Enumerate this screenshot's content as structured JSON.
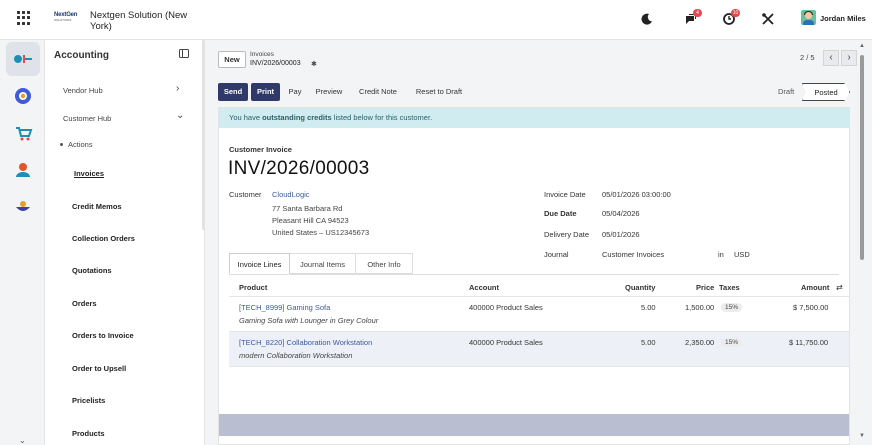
{
  "brand": {
    "logo_line1": "NextGen",
    "logo_line2": "SOLUTIONS",
    "company": "Nextgen Solution (New York)"
  },
  "topbar": {
    "icons": [
      "apps-grid-icon",
      "moon-icon",
      "chat-icon",
      "clock-icon",
      "tools-icon"
    ],
    "chat_badge": "4",
    "activity_badge": "10",
    "user_name": "Jordan Miles"
  },
  "sidebar": {
    "title": "Accounting",
    "items": [
      {
        "label": "Vendor Hub",
        "chevron": "›"
      },
      {
        "label": "Customer Hub",
        "chevron": "⌄"
      },
      {
        "label": "Actions"
      },
      {
        "label": "Invoices"
      },
      {
        "label": "Credit Memos"
      },
      {
        "label": "Collection Orders"
      },
      {
        "label": "Quotations"
      },
      {
        "label": "Orders"
      },
      {
        "label": "Orders to Invoice"
      },
      {
        "label": "Order to Upsell"
      },
      {
        "label": "Pricelists"
      },
      {
        "label": "Products"
      }
    ]
  },
  "control": {
    "new_label": "New",
    "breadcrumb_parent": "Invoices",
    "breadcrumb_current": "INV/2026/00003",
    "pager": "2 / 5",
    "actions": [
      "Send",
      "Print",
      "Pay",
      "Preview",
      "Credit Note",
      "Reset to Draft"
    ],
    "status_draft": "Draft",
    "status_posted": "Posted"
  },
  "alert": {
    "pre": "You have ",
    "bold": "outstanding credits",
    "post": " listed below for this customer."
  },
  "invoice": {
    "kind": "Customer Invoice",
    "name": "INV/2026/00003",
    "customer_label": "Customer",
    "customer_name": "CloudLogic",
    "address": [
      "77 Santa Barbara Rd",
      "Pleasant Hill CA 94523",
      "United States – US12345673"
    ],
    "invoice_date_label": "Invoice Date",
    "invoice_date": "05/01/2026 03:00:00",
    "due_date_label": "Due Date",
    "due_date": "05/04/2026",
    "delivery_date_label": "Delivery Date",
    "delivery_date": "05/01/2026",
    "journal_label": "Journal",
    "journal": "Customer Invoices",
    "in_label": "in",
    "currency": "USD"
  },
  "tabs": [
    "Invoice Lines",
    "Journal Items",
    "Other Info"
  ],
  "lines": {
    "headers": {
      "product": "Product",
      "account": "Account",
      "quantity": "Quantity",
      "price": "Price",
      "taxes": "Taxes",
      "amount": "Amount"
    },
    "rows": [
      {
        "product": "[TECH_8999] Gaming Sofa",
        "description": "Gaming Sofa with Lounger in Grey Colour",
        "account": "400000 Product Sales",
        "quantity": "5.00",
        "price": "1,500.00",
        "tax": "15%",
        "amount": "$ 7,500.00"
      },
      {
        "product": "[TECH_8220] Collaboration Workstation",
        "description": "modern Collaboration Workstation",
        "account": "400000 Product Sales",
        "quantity": "5.00",
        "price": "2,350.00",
        "tax": "15%",
        "amount": "$ 11,750.00"
      }
    ]
  }
}
